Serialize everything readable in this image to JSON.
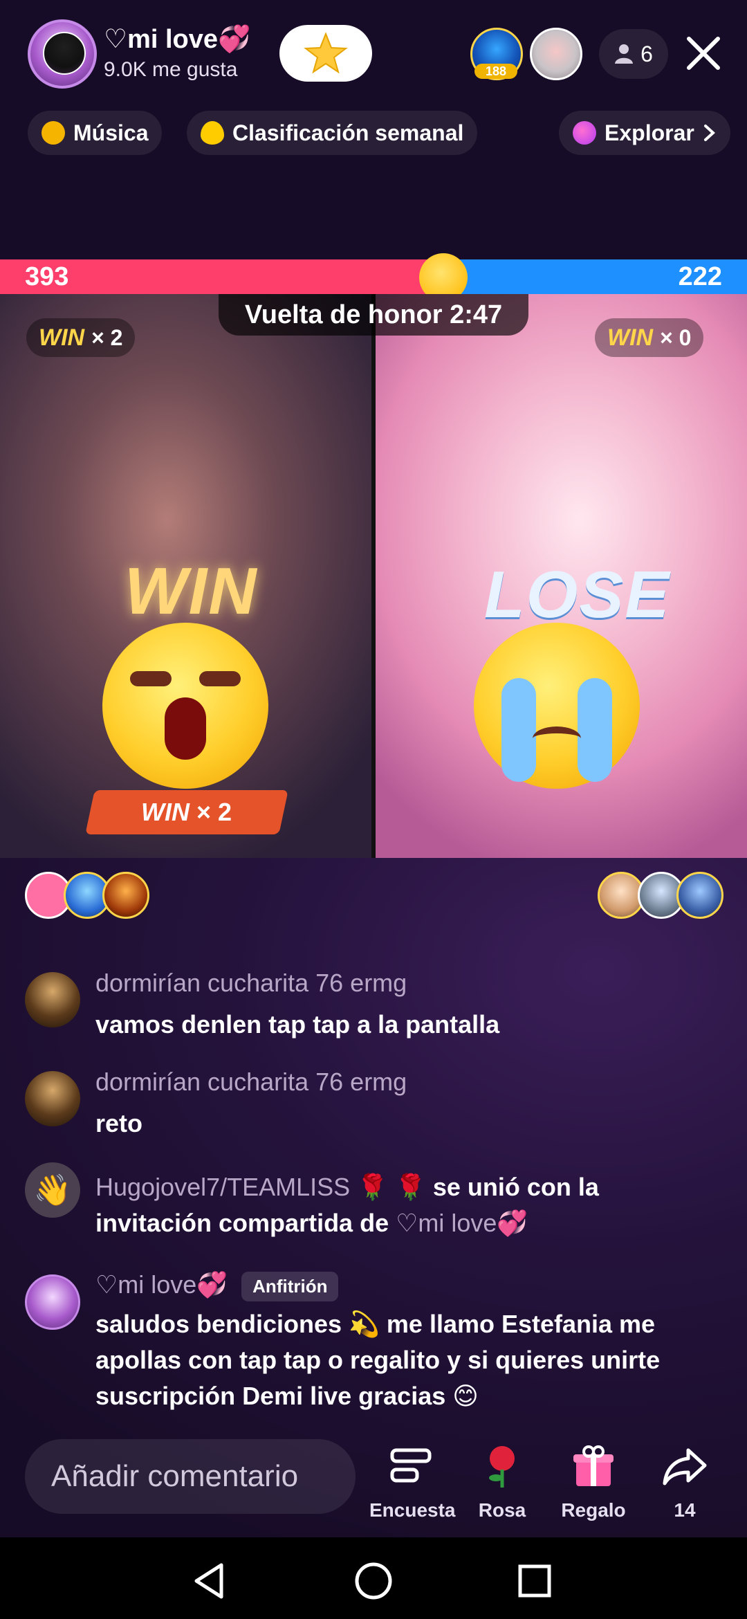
{
  "header": {
    "host_name": "♡mi love💞",
    "likes_text": "9.0K me gusta",
    "viewer_badge": "188",
    "viewer_count": "6"
  },
  "pills": {
    "music": "Música",
    "ranking": "Clasificación semanal",
    "explore": "Explorar"
  },
  "battle": {
    "left_score": "393",
    "right_score": "222",
    "timer": "Vuelta de honor 2:47",
    "left_win_label": "WIN",
    "left_win_count": "× 2",
    "right_win_label": "WIN",
    "right_win_count": "× 0",
    "left_result": "WIN",
    "right_result": "LOSE",
    "left_streak_label": "WIN",
    "left_streak_count": "× 2"
  },
  "chat": [
    {
      "user": "dormirían cucharita 76 ermg",
      "text": "vamos denlen tap tap a la pantalla"
    },
    {
      "user": "dormirían cucharita 76 ermg",
      "text": "reto"
    },
    {
      "user": "Hugojovel7/TEAMLISS 🌹 🌹",
      "text_main": "se unió con la invitación compartida de",
      "text_host": "♡mi love💞"
    },
    {
      "user": "♡mi love💞",
      "badge": "Anfitrión",
      "text": "saludos bendiciones 💫 me llamo Estefania me apollas con tap tap o regalito y si quieres unirte suscripción Demi live gracias 😊"
    }
  ],
  "bottom": {
    "comment_placeholder": "Añadir comentario",
    "poll_label": "Encuesta",
    "rose_label": "Rosa",
    "gift_label": "Regalo",
    "share_count": "14"
  },
  "colors": {
    "score_left": "#ff3f6b",
    "score_right": "#1e90ff",
    "background": "#24123b"
  }
}
